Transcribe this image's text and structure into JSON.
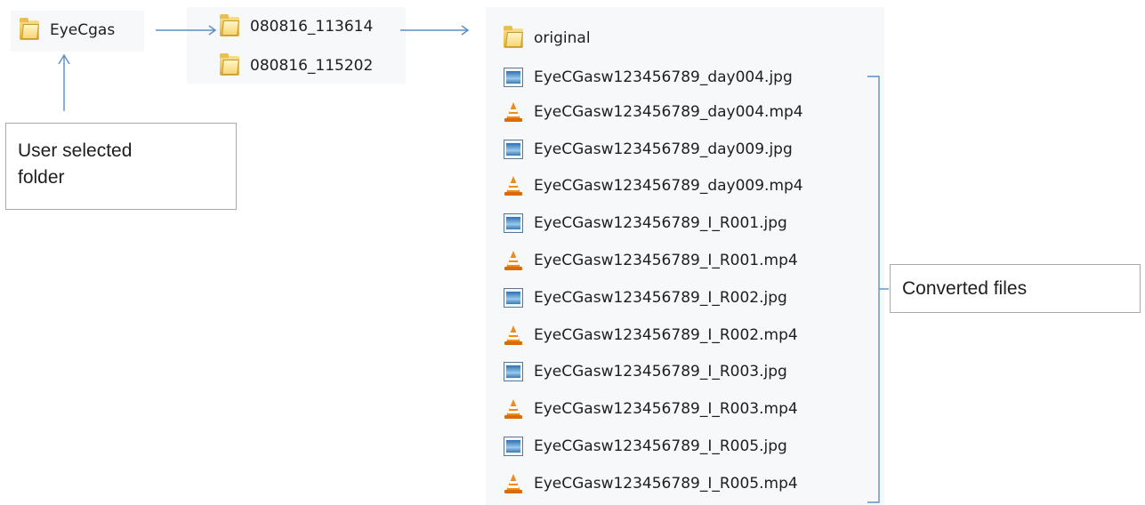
{
  "root_folder": {
    "label": "EyeCgas",
    "icon": "folder-icon"
  },
  "session_folders": [
    {
      "label": "080816_113614",
      "icon": "folder-icon"
    },
    {
      "label": "080816_115202",
      "icon": "folder-icon"
    }
  ],
  "session_contents": [
    {
      "label": "original",
      "icon": "folder-icon"
    },
    {
      "label": "EyeCGasw123456789_day004.jpg",
      "icon": "image-file-icon"
    },
    {
      "label": "EyeCGasw123456789_day004.mp4",
      "icon": "vlc-cone-icon"
    },
    {
      "label": "EyeCGasw123456789_day009.jpg",
      "icon": "image-file-icon"
    },
    {
      "label": "EyeCGasw123456789_day009.mp4",
      "icon": "vlc-cone-icon"
    },
    {
      "label": "EyeCGasw123456789_I_R001.jpg",
      "icon": "image-file-icon"
    },
    {
      "label": "EyeCGasw123456789_I_R001.mp4",
      "icon": "vlc-cone-icon"
    },
    {
      "label": "EyeCGasw123456789_I_R002.jpg",
      "icon": "image-file-icon"
    },
    {
      "label": "EyeCGasw123456789_I_R002.mp4",
      "icon": "vlc-cone-icon"
    },
    {
      "label": "EyeCGasw123456789_I_R003.jpg",
      "icon": "image-file-icon"
    },
    {
      "label": "EyeCGasw123456789_I_R003.mp4",
      "icon": "vlc-cone-icon"
    },
    {
      "label": "EyeCGasw123456789_I_R005.jpg",
      "icon": "image-file-icon"
    },
    {
      "label": "EyeCGasw123456789_I_R005.mp4",
      "icon": "vlc-cone-icon"
    }
  ],
  "annotations": {
    "user_selected": {
      "line1": "User selected",
      "line2": "folder"
    },
    "converted": "Converted files"
  },
  "colors": {
    "connector": "#5b8ec9",
    "folder": "#eec65a",
    "vlc": "#f08a18",
    "image": "#2f6fb0"
  }
}
